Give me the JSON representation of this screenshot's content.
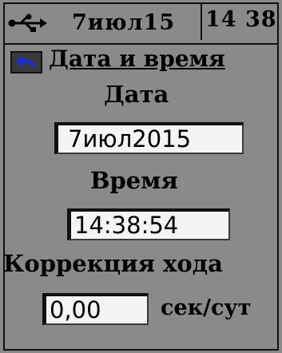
{
  "status": {
    "icon": "usb-icon",
    "date": "7июл15",
    "time": "14 38"
  },
  "header": {
    "back_icon": "back-arrow-icon",
    "title": "Дата и время"
  },
  "date_section": {
    "label": "Дата",
    "value": "7июл2015"
  },
  "time_section": {
    "label": "Время",
    "value": "14:38:54"
  },
  "correction_section": {
    "label": "Коррекция хода",
    "value": "0,00",
    "units": "сек/сут"
  },
  "colors": {
    "screen_background": "#8a8a8a",
    "field_background": "#f4f4f4",
    "ink": "#000000",
    "back_button_arrow": "#1c2fd0"
  }
}
